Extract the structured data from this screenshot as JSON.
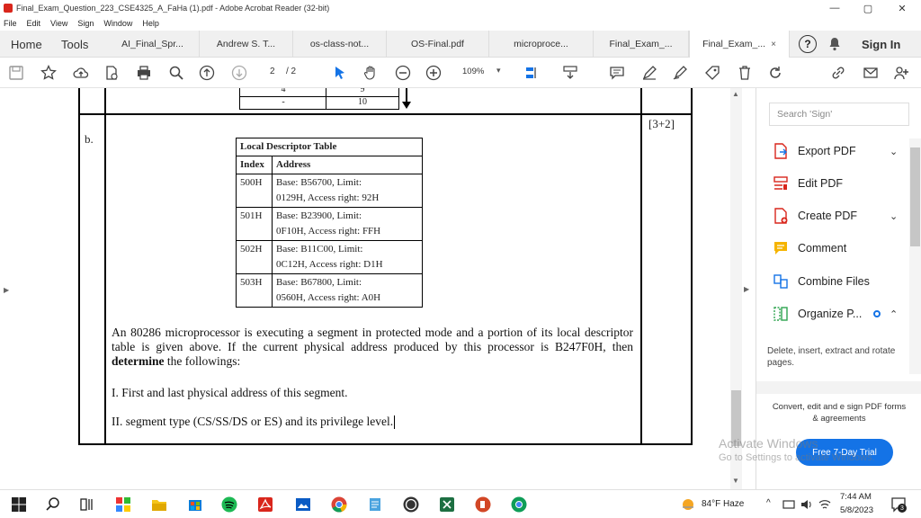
{
  "window": {
    "title": "Final_Exam_Question_223_CSE4325_A_FaHa (1).pdf - Adobe Acrobat Reader (32-bit)",
    "minimize": "—",
    "restore": "▢",
    "close": "✕"
  },
  "menu": [
    "File",
    "Edit",
    "View",
    "Sign",
    "Window",
    "Help"
  ],
  "tabs": {
    "home": "Home",
    "tools": "Tools",
    "docs": [
      "AI_Final_Spr...",
      "Andrew S. T...",
      "os-class-not...",
      "OS-Final.pdf",
      "microproce...",
      "Final_Exam_..."
    ],
    "active": "Final_Exam_...",
    "close_glyph": "×",
    "help_glyph": "?",
    "sign_in": "Sign In"
  },
  "toolbar": {
    "page_current": "2",
    "page_total": "/ 2",
    "zoom": "109%",
    "zoom_caret": "▾"
  },
  "document": {
    "mini_table": {
      "left_top": "4",
      "left_bottom": "-",
      "right_top": "9",
      "right_bottom": "10"
    },
    "marks": "[3+2]",
    "label": "b.",
    "ldt": {
      "title": "Local Descriptor Table",
      "headers": [
        "Index",
        "Address"
      ],
      "rows": [
        {
          "index": "500H",
          "line1": "Base: B56700, Limit:",
          "line2": "0129H, Access right: 92H"
        },
        {
          "index": "501H",
          "line1": "Base: B23900, Limit:",
          "line2": "0F10H, Access right: FFH"
        },
        {
          "index": "502H",
          "line1": "Base: B11C00, Limit:",
          "line2": "0C12H, Access right: D1H"
        },
        {
          "index": "503H",
          "line1": "Base: B67800, Limit:",
          "line2": "0560H, Access right: A0H"
        }
      ]
    },
    "para_before": "An 80286 microprocessor is executing a segment in protected mode and a portion of its local descriptor table is given above. If the current physical address produced by this processor is B247F0H, then ",
    "para_bold": "determine",
    "para_after": " the followings:",
    "q1": "I. First and last physical address of this segment.",
    "q2": "II. segment type (CS/SS/DS or ES) and its privilege level."
  },
  "right_panel": {
    "search_placeholder": "Search 'Sign'",
    "tools": [
      {
        "label": "Export PDF",
        "chevron": "⌄"
      },
      {
        "label": "Edit PDF",
        "chevron": ""
      },
      {
        "label": "Create PDF",
        "chevron": "⌄"
      },
      {
        "label": "Comment",
        "chevron": ""
      },
      {
        "label": "Combine Files",
        "chevron": ""
      },
      {
        "label": "Organize P...",
        "chevron": "⌃"
      }
    ],
    "organize_desc": "Delete, insert, extract and rotate pages.",
    "promo": "Convert, edit and e sign PDF forms & agreements",
    "trial_button": "Free 7-Day Trial"
  },
  "watermark": {
    "line1": "Activate Windows",
    "line2": "Go to Settings to activate Windows."
  },
  "taskbar": {
    "weather": "84°F  Haze",
    "time": "7:44 AM",
    "date": "5/8/2023",
    "notification_count": "3"
  },
  "colors": {
    "acrobat_red": "#d9261c",
    "accent_blue": "#1473e6"
  }
}
